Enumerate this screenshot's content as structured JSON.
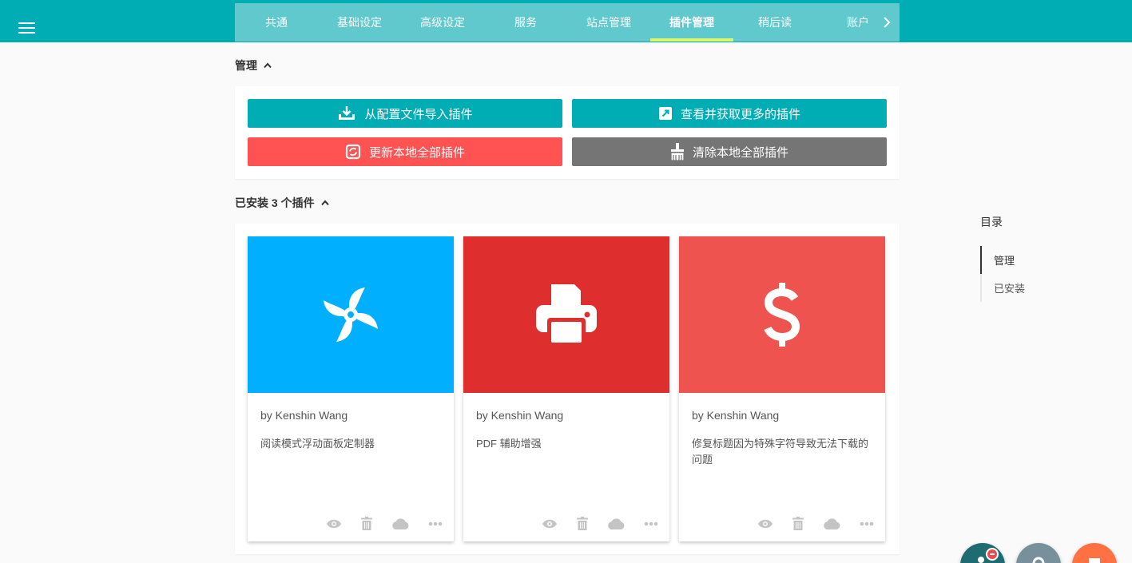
{
  "tabs": [
    {
      "label": "共通"
    },
    {
      "label": "基础设定"
    },
    {
      "label": "高级设定"
    },
    {
      "label": "服务"
    },
    {
      "label": "站点管理"
    },
    {
      "label": "插件管理"
    },
    {
      "label": "稍后读"
    },
    {
      "label": "账户"
    }
  ],
  "active_tab": "插件管理",
  "manage": {
    "title": "管理",
    "buttons": {
      "import": "从配置文件导入插件",
      "more": "查看并获取更多的插件",
      "update": "更新本地全部插件",
      "clear": "清除本地全部插件"
    }
  },
  "installed": {
    "title": "已安装 3 个插件",
    "plugins": [
      {
        "author": "by Kenshin Wang",
        "description": "阅读模式浮动面板定制器",
        "icon": "pinwheel-icon",
        "color": "#00b0ff"
      },
      {
        "author": "by Kenshin Wang",
        "description": "PDF 辅助增强",
        "icon": "printer-icon",
        "color": "#de2e2e"
      },
      {
        "author": "by Kenshin Wang",
        "description": "修复标题因为特殊字符导致无法下载的问题",
        "icon": "dollar-icon",
        "color": "#ef5350"
      }
    ]
  },
  "toc": {
    "title": "目录",
    "items": [
      {
        "label": "管理",
        "active": true
      },
      {
        "label": "已安装",
        "active": false
      }
    ]
  },
  "colors": {
    "topbar": "#00adb5",
    "tabs_bg": "#5fc9ce",
    "tab_indicator": "#d8f96a",
    "btn_teal": "#00adb5",
    "btn_red": "#ff5252",
    "btn_gray": "#757575"
  }
}
